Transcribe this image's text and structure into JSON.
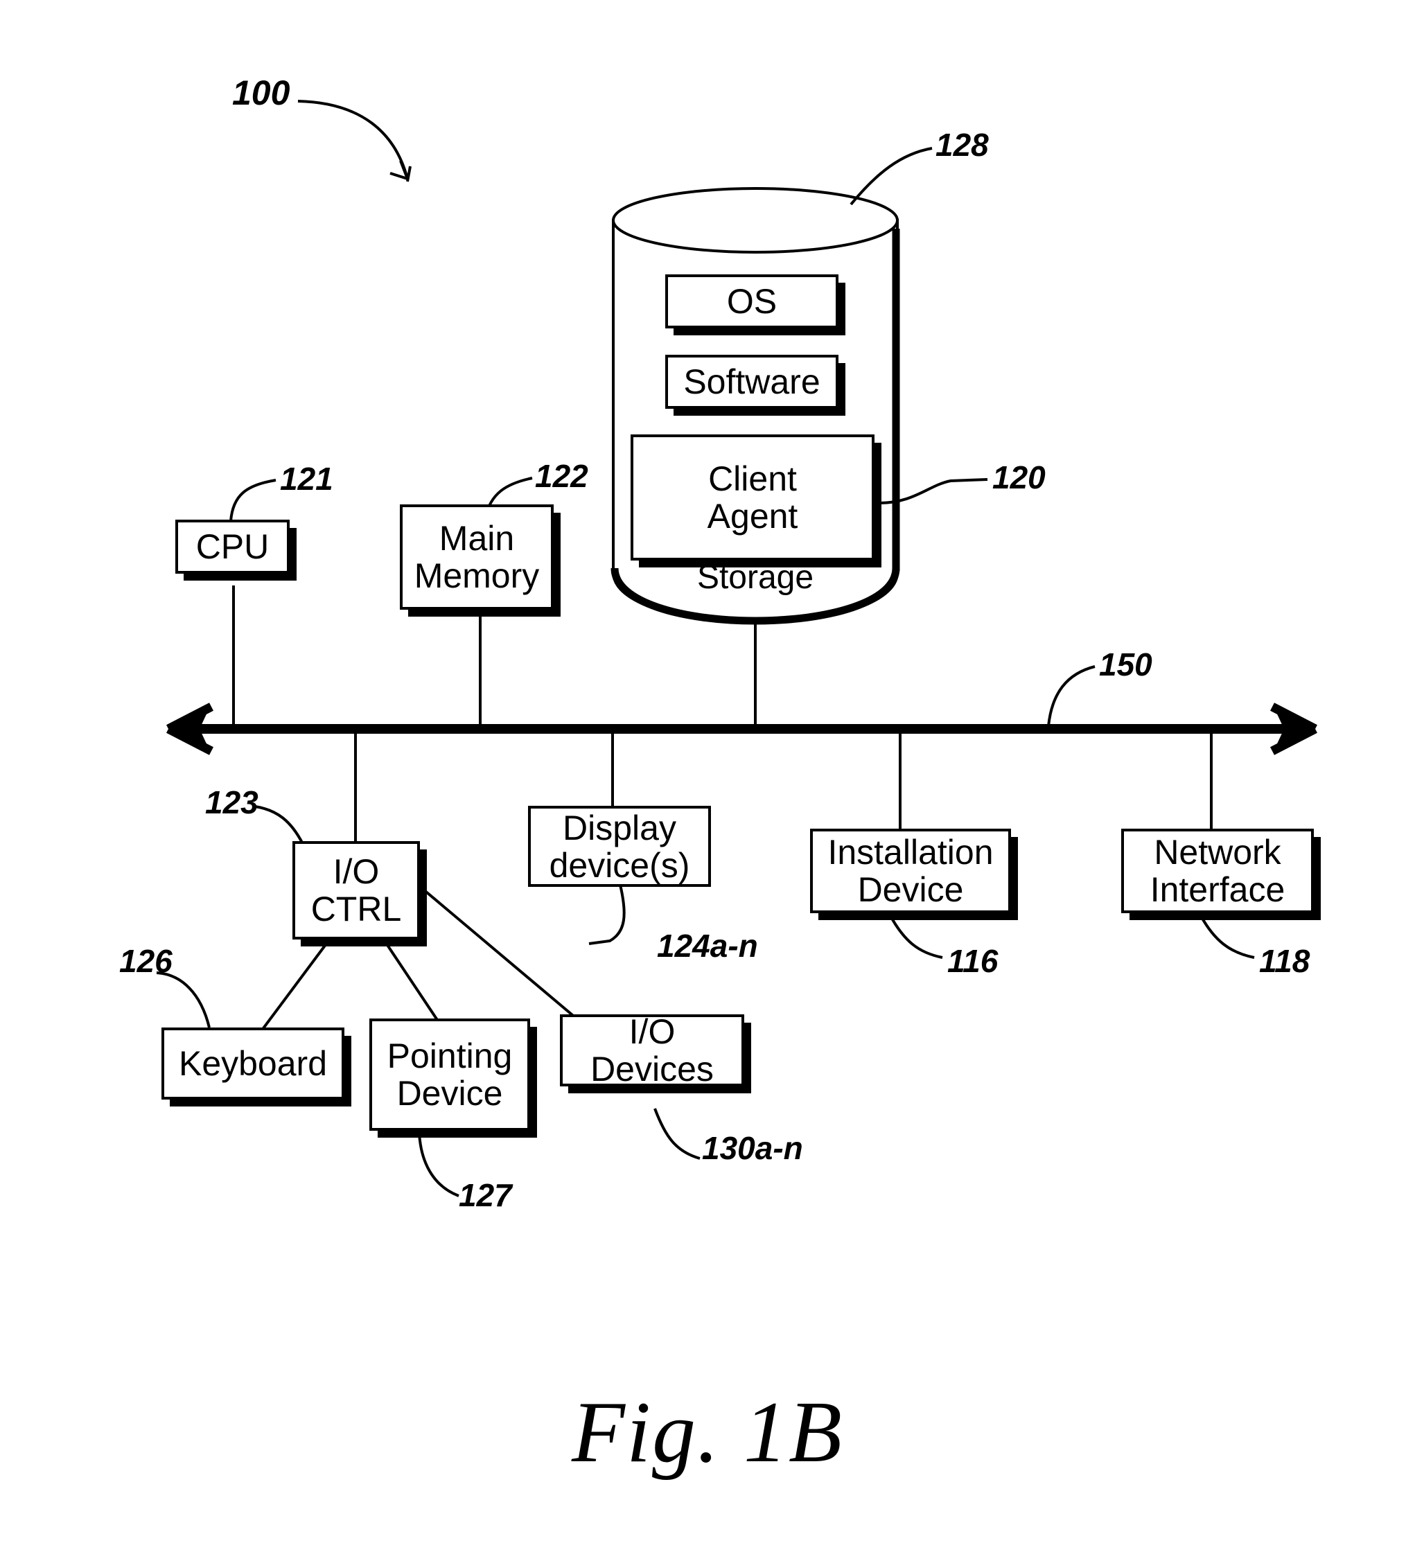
{
  "figure": {
    "caption": "Fig. 1B",
    "system_ref": "100"
  },
  "storage": {
    "label": "Storage",
    "ref": "128",
    "contents": [
      {
        "label": "OS",
        "name": "os-box"
      },
      {
        "label": "Software",
        "name": "software-box"
      },
      {
        "label": "Client\nAgent",
        "name": "client-agent-box",
        "ref": "120"
      }
    ]
  },
  "bus": {
    "ref": "150"
  },
  "nodes": {
    "cpu": {
      "label": "CPU",
      "ref": "121"
    },
    "main_memory": {
      "label": "Main\nMemory",
      "ref": "122"
    },
    "io_ctrl": {
      "label": "I/O\nCTRL",
      "ref": "123"
    },
    "display": {
      "label": "Display\ndevice(s)",
      "ref": "124a-n"
    },
    "installation": {
      "label": "Installation\nDevice",
      "ref": "116"
    },
    "network": {
      "label": "Network\nInterface",
      "ref": "118"
    },
    "keyboard": {
      "label": "Keyboard",
      "ref": "126"
    },
    "pointing": {
      "label": "Pointing\nDevice",
      "ref": "127"
    },
    "io_devices": {
      "label": "I/O Devices",
      "ref": "130a-n"
    }
  },
  "colors": {
    "ink": "#000000",
    "paper": "#ffffff"
  }
}
